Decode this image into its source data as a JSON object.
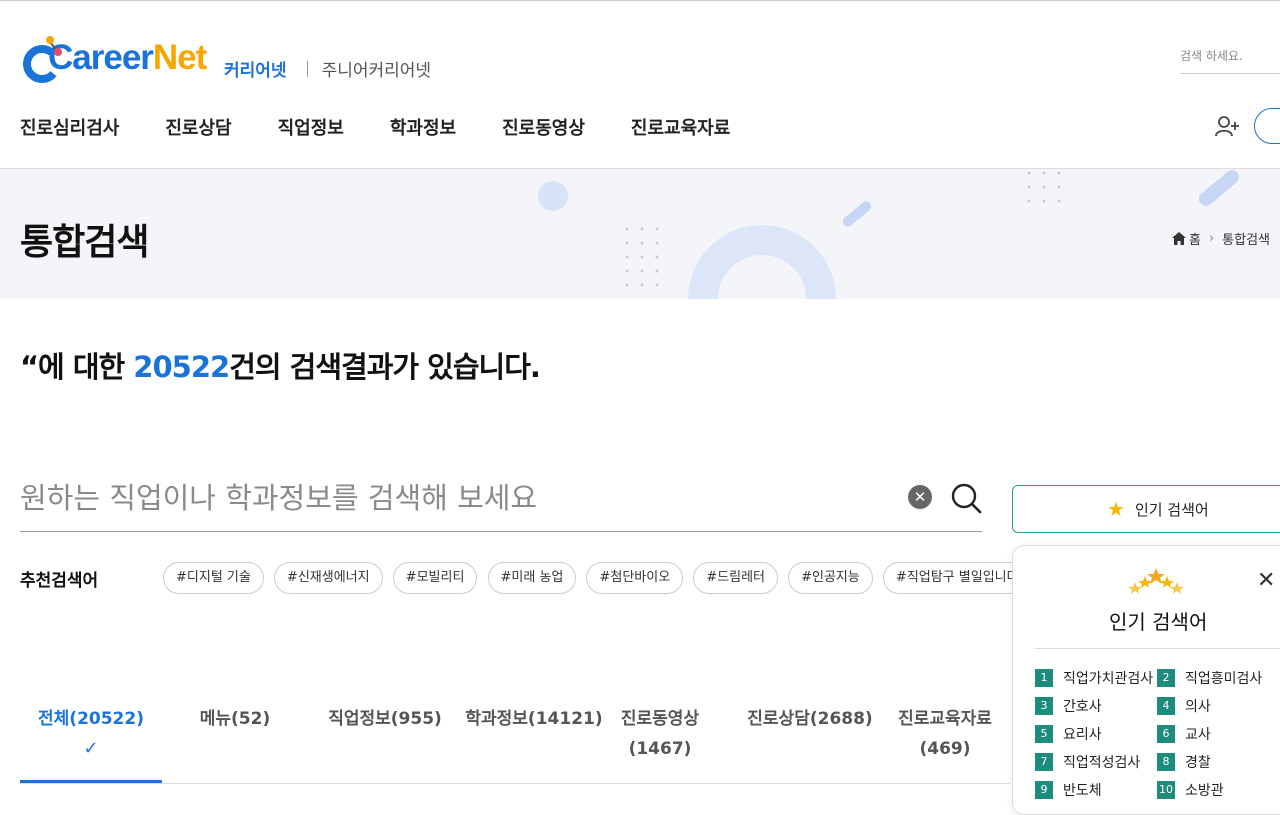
{
  "header": {
    "logo_text_a": "Career",
    "logo_text_b": "Net",
    "site_tab_active": "커리어넷",
    "site_tab_other": "주니어커리어넷",
    "search_placeholder": "검색 하세요."
  },
  "gnb": [
    "진로심리검사",
    "진로상담",
    "직업정보",
    "학과정보",
    "진로동영상",
    "진로교육자료"
  ],
  "banner": {
    "title": "통합검색",
    "breadcrumb_home": "홈",
    "breadcrumb_current": "통합검색"
  },
  "result": {
    "prefix": "“에 대한 ",
    "count": "20522",
    "suffix": "건의 검색결과가 있습니다."
  },
  "search": {
    "placeholder": "원하는 직업이나 학과정보를 검색해 보세요"
  },
  "recommend": {
    "label": "추천검색어",
    "tags": [
      "#디지털 기술",
      "#신재생에너지",
      "#모빌리티",
      "#미래 농업",
      "#첨단바이오",
      "#드림레터",
      "#인공지능",
      "#직업탐구 별일입니다"
    ]
  },
  "tabs": [
    {
      "label": "전체(20522)"
    },
    {
      "label": "메뉴(52)"
    },
    {
      "label": "직업정보(955)"
    },
    {
      "label": "학과정보(14121)"
    },
    {
      "label": "진로동영상\n(1467)"
    },
    {
      "label": "진로상담(2688)"
    },
    {
      "label": "진로교육자료\n(469)"
    }
  ],
  "popular": {
    "button_label": "인기 검색어",
    "panel_title": "인기 검색어",
    "items": [
      {
        "rank": "1",
        "label": "직업가치관검사"
      },
      {
        "rank": "2",
        "label": "직업흥미검사"
      },
      {
        "rank": "3",
        "label": "간호사"
      },
      {
        "rank": "4",
        "label": "의사"
      },
      {
        "rank": "5",
        "label": "요리사"
      },
      {
        "rank": "6",
        "label": "교사"
      },
      {
        "rank": "7",
        "label": "직업적성검사"
      },
      {
        "rank": "8",
        "label": "경찰"
      },
      {
        "rank": "9",
        "label": "반도체"
      },
      {
        "rank": "10",
        "label": "소방관"
      }
    ]
  },
  "colors": {
    "brand_blue": "#1a73d9",
    "brand_orange": "#f7a600",
    "teal": "#1d8c7c"
  }
}
